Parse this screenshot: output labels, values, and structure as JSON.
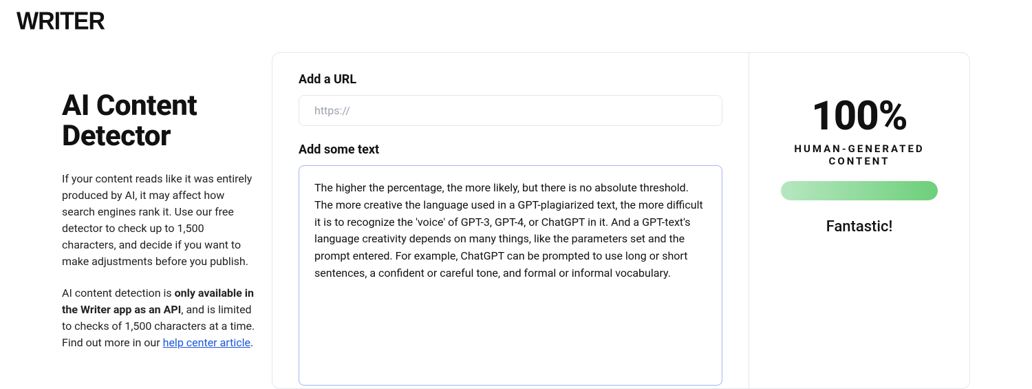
{
  "logo": "WRITER",
  "title": "AI Content Detector",
  "description_p1": "If your content reads like it was entirely produced by AI, it may affect how search engines rank it. Use our free detector to check up to 1,500 characters, and decide if you want to make adjustments before you publish.",
  "description_p2_prefix": "AI content detection is ",
  "description_p2_bold": "only available in the Writer app as an API",
  "description_p2_mid": ", and is limited to checks of 1,500 characters at a time. Find out more in our ",
  "description_p2_link": "help center article",
  "description_p2_suffix": ".",
  "form": {
    "url_label": "Add a URL",
    "url_placeholder": "https://",
    "text_label": "Add some text",
    "text_value": "The higher the percentage, the more likely, but there is no absolute threshold. The more creative the language used in a GPT-plagiarized text, the more difficult it is to recognize the 'voice' of GPT-3, GPT-4, or ChatGPT in it. And a GPT-text's language creativity depends on many things, like the parameters set and the prompt entered. For example, ChatGPT can be prompted to use long or short sentences, a confident or careful tone, and formal or informal vocabulary."
  },
  "result": {
    "score": "100%",
    "label": "HUMAN-GENERATED CONTENT",
    "feedback": "Fantastic!",
    "progress_percent": 100
  }
}
